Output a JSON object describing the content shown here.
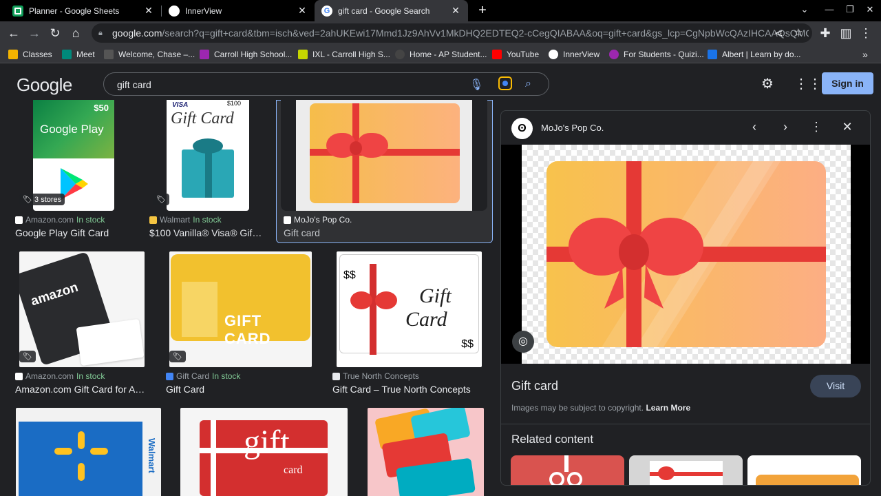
{
  "tabs": [
    {
      "label": "Planner - Google Sheets",
      "icon": "sheets-icon"
    },
    {
      "label": "InnerView",
      "icon": "innerview-icon"
    },
    {
      "label": "gift card - Google Search",
      "icon": "google-icon",
      "active": true
    }
  ],
  "toolbar": {
    "url_host": "google.com",
    "url_rest": "/search?q=gift+card&tbm=isch&ved=2ahUKEwi17Mmd1Jz9AhVv1MkDHQ2EDTEQ2-cCegQIABAA&oq=gift+card&gs_lcp=CgNpbWcQAzIHCAAQsQMQ..."
  },
  "bookmarks": [
    {
      "label": "Classes",
      "color": "#f4b400"
    },
    {
      "label": "Meet",
      "color": "#00897b"
    },
    {
      "label": "Welcome, Chase –...",
      "color": "#555555"
    },
    {
      "label": "Carroll High School...",
      "color": "#9c27b0"
    },
    {
      "label": "IXL - Carroll High S...",
      "color": "#c6d600"
    },
    {
      "label": "Home - AP Student...",
      "color": "#444444"
    },
    {
      "label": "YouTube",
      "color": "#ff0000"
    },
    {
      "label": "InnerView",
      "color": "#ffffff"
    },
    {
      "label": "For Students - Quizi...",
      "color": "#9c27b0"
    },
    {
      "label": "Albert | Learn by do...",
      "color": "#1a73e8"
    }
  ],
  "header": {
    "logo": "Google",
    "query": "gift card",
    "signin": "Sign in"
  },
  "results": [
    {
      "source": "Amazon.com",
      "stock": "In stock",
      "title": "Google Play Gift Card",
      "badge": "3 stores"
    },
    {
      "source": "Walmart",
      "stock": "In stock",
      "title": "$100 Vanilla® Visa® Gift ..."
    },
    {
      "source": "MoJo's Pop Co.",
      "stock": "",
      "title": "Gift card"
    },
    {
      "source": "Amazon.com",
      "stock": "In stock",
      "title": "Amazon.com Gift Card for Any..."
    },
    {
      "source": "Gift Card",
      "stock": "In stock",
      "title": "Gift Card"
    },
    {
      "source": "True North Concepts",
      "stock": "",
      "title": "Gift Card – True North Concepts"
    }
  ],
  "thumb_text": {
    "gplay_amount": "$50",
    "gplay_name": "Google Play",
    "vanilla_brand": "VISA",
    "vanilla_script": "Gift Card",
    "vanilla_amount": "$100",
    "amazon_word": "amazon",
    "yellow_card": "GIFT CARD",
    "tn_dollars": "$$",
    "tn_script1": "Gift",
    "tn_script2": "Card",
    "walmart": "Walmart",
    "red_gift": "gift",
    "red_card": "card"
  },
  "panel": {
    "source": "MoJo's Pop Co.",
    "title": "Gift card",
    "visit": "Visit",
    "copyright": "Images may be subject to copyright.",
    "learn_more": "Learn More",
    "related": "Related content"
  }
}
